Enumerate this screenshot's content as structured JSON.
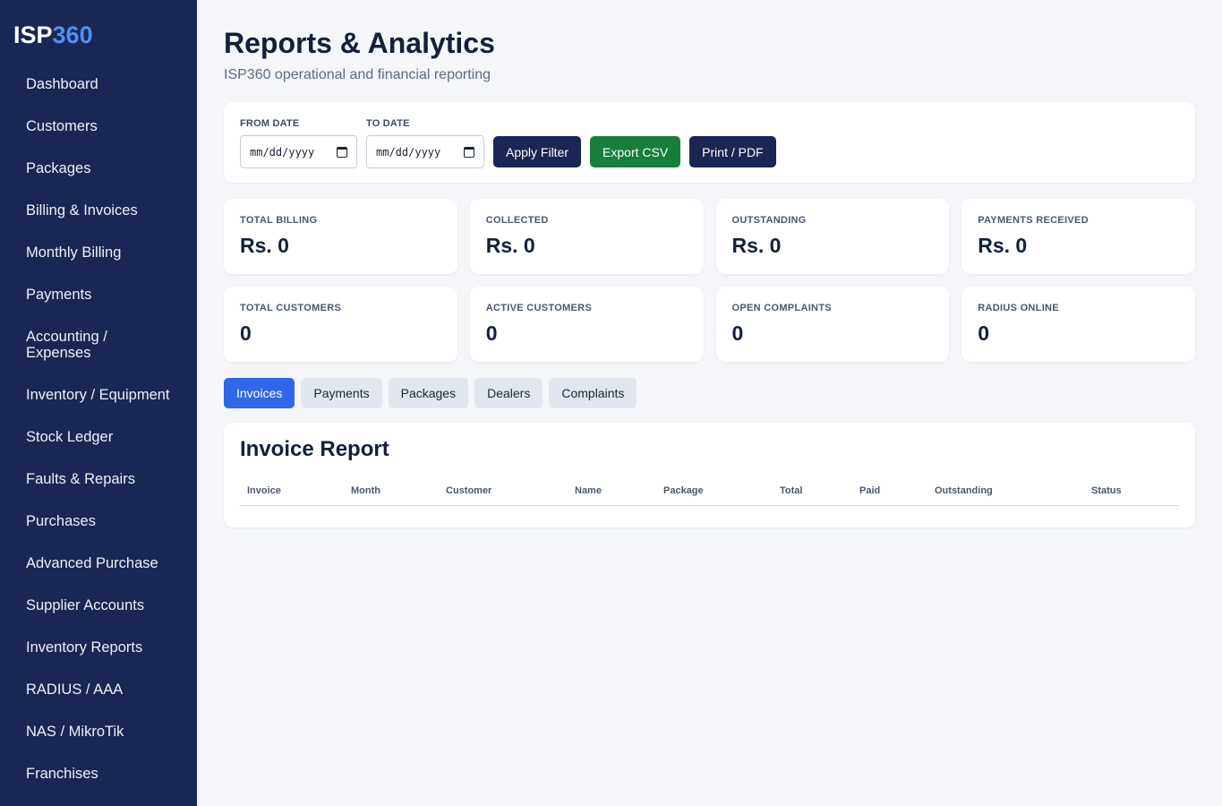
{
  "brand": {
    "prefix": "ISP",
    "suffix": "360"
  },
  "sidebar": {
    "items": [
      {
        "label": "Dashboard"
      },
      {
        "label": "Customers"
      },
      {
        "label": "Packages"
      },
      {
        "label": "Billing & Invoices"
      },
      {
        "label": "Monthly Billing"
      },
      {
        "label": "Payments"
      },
      {
        "label": "Accounting / Expenses"
      },
      {
        "label": "Inventory / Equipment"
      },
      {
        "label": "Stock Ledger"
      },
      {
        "label": "Faults & Repairs"
      },
      {
        "label": "Purchases"
      },
      {
        "label": "Advanced Purchase"
      },
      {
        "label": "Supplier Accounts"
      },
      {
        "label": "Inventory Reports"
      },
      {
        "label": "RADIUS / AAA"
      },
      {
        "label": "NAS / MikroTik"
      },
      {
        "label": "Franchises"
      }
    ]
  },
  "header": {
    "title": "Reports & Analytics",
    "subtitle": "ISP360 operational and financial reporting"
  },
  "filters": {
    "from_label": "FROM DATE",
    "from_value": "mm/dd/yyyy",
    "to_label": "TO DATE",
    "to_value": "mm/dd/yyyy",
    "apply_label": "Apply Filter",
    "export_label": "Export CSV",
    "print_label": "Print / PDF"
  },
  "stats_financial": [
    {
      "label": "TOTAL BILLING",
      "value": "Rs. 0"
    },
    {
      "label": "COLLECTED",
      "value": "Rs. 0"
    },
    {
      "label": "OUTSTANDING",
      "value": "Rs. 0"
    },
    {
      "label": "PAYMENTS RECEIVED",
      "value": "Rs. 0"
    }
  ],
  "stats_operational": [
    {
      "label": "TOTAL CUSTOMERS",
      "value": "0"
    },
    {
      "label": "ACTIVE CUSTOMERS",
      "value": "0"
    },
    {
      "label": "OPEN COMPLAINTS",
      "value": "0"
    },
    {
      "label": "RADIUS ONLINE",
      "value": "0"
    }
  ],
  "tabs": [
    {
      "label": "Invoices",
      "active": true
    },
    {
      "label": "Payments",
      "active": false
    },
    {
      "label": "Packages",
      "active": false
    },
    {
      "label": "Dealers",
      "active": false
    },
    {
      "label": "Complaints",
      "active": false
    }
  ],
  "report": {
    "title": "Invoice Report",
    "columns": [
      "Invoice",
      "Month",
      "Customer",
      "Name",
      "Package",
      "Total",
      "Paid",
      "Outstanding",
      "Status"
    ]
  },
  "colors": {
    "sidebar_bg": "#1a2653",
    "brand_accent": "#4f8ff7",
    "primary_navy": "#1a2653",
    "export_green": "#16803b",
    "active_tab": "#2f67e6"
  },
  "icons": {
    "date_picker": "calendar-icon"
  }
}
